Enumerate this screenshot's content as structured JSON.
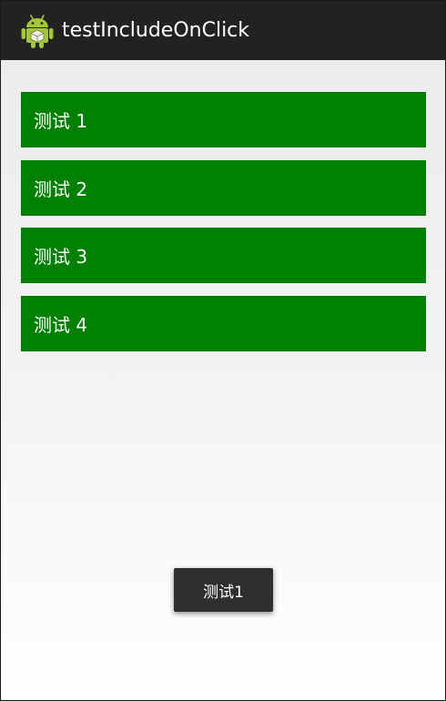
{
  "action_bar": {
    "title": "testIncludeOnClick",
    "icon": "android-robot-icon",
    "background": "#222222"
  },
  "items": [
    {
      "label": "测试 1"
    },
    {
      "label": "测试 2"
    },
    {
      "label": "测试 3"
    },
    {
      "label": "测试 4"
    }
  ],
  "item_color": "#008000",
  "toast": {
    "text": "测试1"
  }
}
